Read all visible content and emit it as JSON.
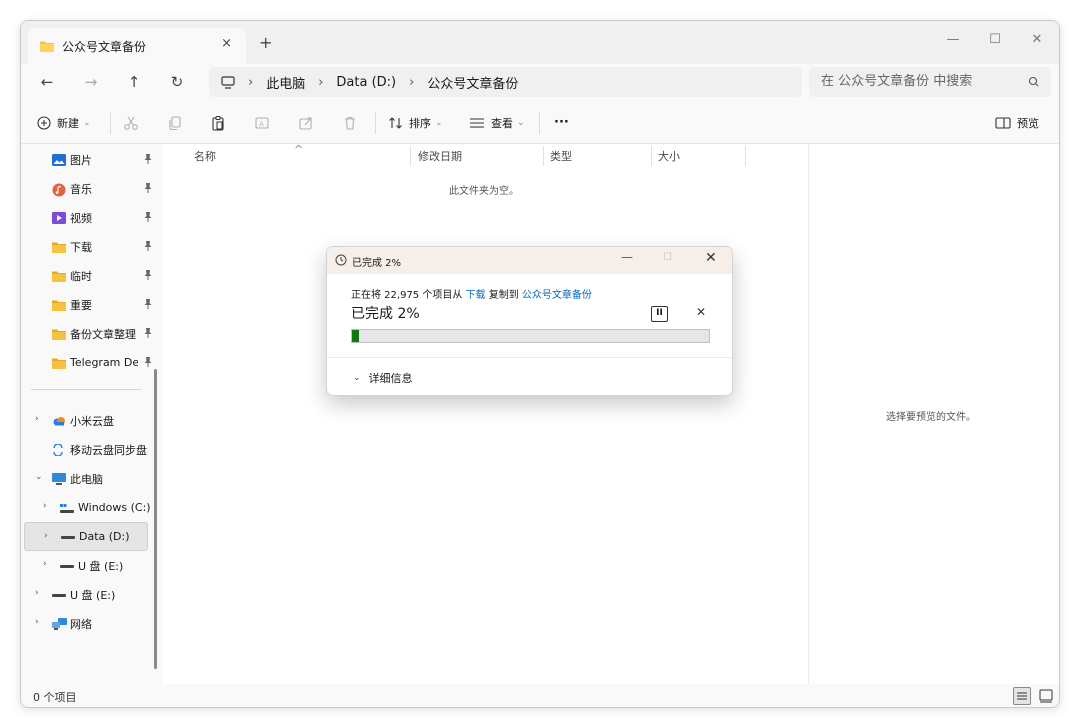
{
  "window": {
    "tab_title": "公众号文章备份",
    "tab_close": "×",
    "tab_add": "+",
    "min": "—",
    "max": "☐",
    "close": "✕"
  },
  "nav": {
    "back": "←",
    "forward": "→",
    "up": "↑",
    "refresh": "↻",
    "breadcrumb": [
      "此电脑",
      "Data (D:)",
      "公众号文章备份"
    ],
    "separator": "›",
    "search_placeholder": "在 公众号文章备份 中搜索"
  },
  "toolbar": {
    "new_label": "新建",
    "sort_label": "排序",
    "view_label": "查看",
    "more_label": "···",
    "preview_label": "预览",
    "dropdown": "⌄"
  },
  "sidebar": {
    "quick_access": [
      {
        "label": "图片",
        "icon": "pictures-icon",
        "color": "#1f6fd1"
      },
      {
        "label": "音乐",
        "icon": "music-icon",
        "color": "#e2633a"
      },
      {
        "label": "视频",
        "icon": "videos-icon",
        "color": "#7a4cd9"
      },
      {
        "label": "下载",
        "icon": "folder-icon",
        "color": "#f5c242"
      },
      {
        "label": "临时",
        "icon": "folder-icon",
        "color": "#f5c242"
      },
      {
        "label": "重要",
        "icon": "folder-icon",
        "color": "#f5c242"
      },
      {
        "label": "备份文章整理",
        "icon": "folder-icon",
        "color": "#f5c242"
      },
      {
        "label": "Telegram Desktop",
        "icon": "folder-icon",
        "color": "#f5c242"
      }
    ],
    "tree": [
      {
        "label": "小米云盘",
        "icon": "cloud-icon",
        "chevron": "›"
      },
      {
        "label": "移动云盘同步盘",
        "icon": "sync-cloud-icon",
        "chevron": ""
      },
      {
        "label": "此电脑",
        "icon": "pc-icon",
        "chevron": "⌄"
      },
      {
        "label": "Windows (C:)",
        "icon": "windows-drive-icon",
        "chevron": "›"
      },
      {
        "label": "Data (D:)",
        "icon": "drive-icon",
        "chevron": "›"
      },
      {
        "label": "U 盘 (E:)",
        "icon": "drive-icon",
        "chevron": "›"
      },
      {
        "label": "U 盘 (E:)",
        "icon": "drive-icon",
        "chevron": "›"
      },
      {
        "label": "网络",
        "icon": "network-icon",
        "chevron": "›"
      }
    ]
  },
  "filelist": {
    "columns": [
      "名称",
      "修改日期",
      "类型",
      "大小"
    ],
    "sort_indicator": "^",
    "empty_text": "此文件夹为空。"
  },
  "preview_pane": {
    "text": "选择要预览的文件。"
  },
  "status": {
    "item_count": "0 个项目"
  },
  "copy_dialog": {
    "title": "已完成 2%",
    "desc_prefix": "正在将 22,975 个项目从 ",
    "source": "下载",
    "desc_mid": " 复制到 ",
    "destination": "公众号文章备份",
    "progress_label": "已完成 2%",
    "progress_percent": 2,
    "pause": "II",
    "cancel": "✕",
    "min": "—",
    "max": "☐",
    "close": "✕",
    "details_label": "详细信息",
    "details_chevron": "⌄"
  },
  "colors": {
    "accent": "#0067c0",
    "progress": "#0f7a0f",
    "folder": "#f5c242"
  }
}
